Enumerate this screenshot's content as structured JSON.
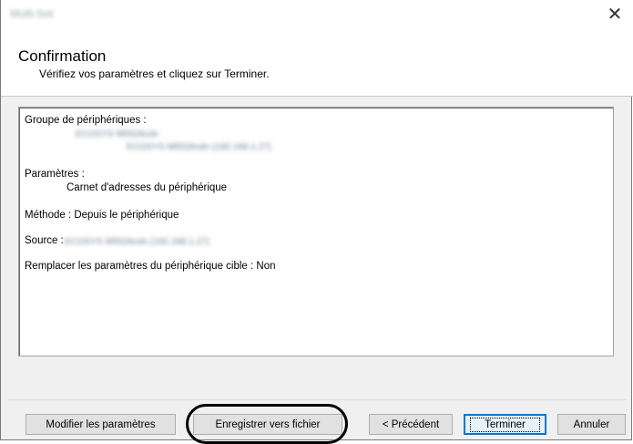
{
  "window": {
    "title": "Multi-Set",
    "close_glyph": "✕"
  },
  "header": {
    "title": "Confirmation",
    "subtitle": "Vérifiez vos paramètres et cliquez sur Terminer."
  },
  "summary": {
    "group_label": "Groupe de périphériques :",
    "group_device_1": "ECOSYS M5526cdn",
    "group_device_2": "ECOSYS M5526cdn (192.168.1.27)",
    "settings_label": "Paramètres :",
    "settings_value": "Carnet d'adresses du périphérique",
    "method_line": "Méthode : Depuis le périphérique",
    "source_label": "Source :",
    "source_value": "ECOSYS M5526cdn (192.168.1.27)",
    "replace_line": "Remplacer les paramètres du périphérique cible : Non"
  },
  "buttons": {
    "modify": "Modifier les paramètres",
    "save_to_file": "Enregistrer vers fichier",
    "previous": "< Précédent",
    "finish": "Terminer",
    "cancel": "Annuler"
  },
  "colors": {
    "default_button_border": "#0078d7",
    "highlight_ring": "#000000"
  }
}
